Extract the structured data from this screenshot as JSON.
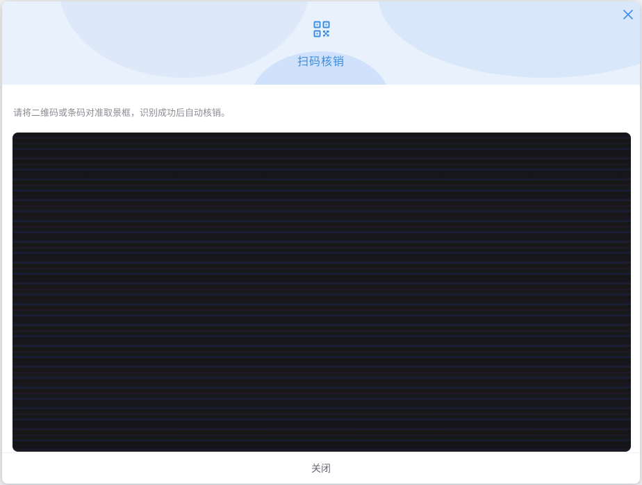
{
  "dialog": {
    "title": "扫码核销",
    "instruction": "请将二维码或条码对准取景框，识别成功后自动核销。",
    "close_button_label": "关闭",
    "header_icon": "qr-code-icon",
    "close_icon": "close-icon"
  },
  "colors": {
    "accent": "#3b8ee0",
    "header_bg": "#e8f1fc",
    "camera_bg": "#17171d"
  }
}
